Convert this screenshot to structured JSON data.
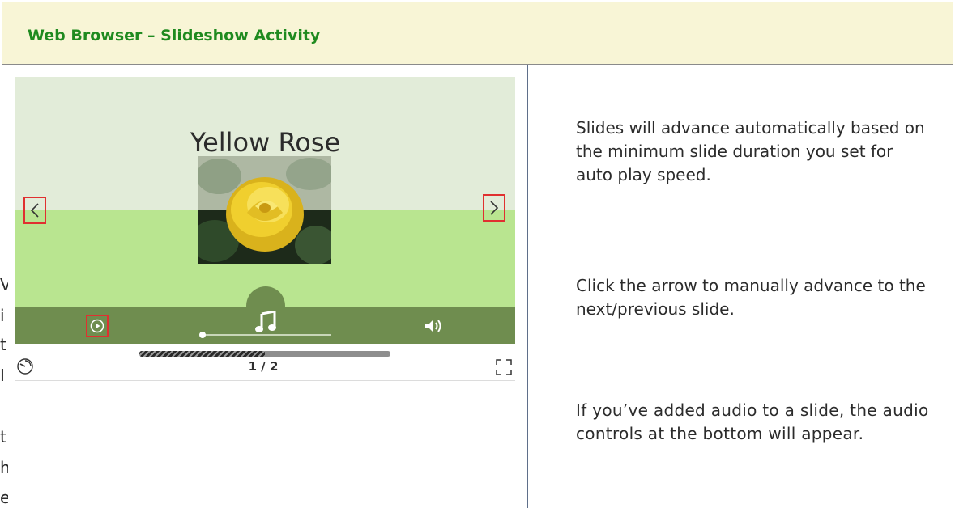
{
  "header": {
    "title": "Web Browser – Slideshow Activity"
  },
  "slideshow": {
    "slide_title": "Yellow Rose",
    "page_counter": "1 / 2",
    "progress": 0.5,
    "audio_position": 0.0
  },
  "left_fragments": [
    "V",
    "i",
    "t",
    "I",
    "t",
    "h",
    "e"
  ],
  "instructions": {
    "p1": "Slides will advance automatically based on the minimum slide duration you set for auto play speed.",
    "p2": "Click the arrow to manually advance to the next/previous slide.",
    "p3": "If you’ve added audio to a slide, the audio controls at the bottom will appear."
  },
  "colors": {
    "header_bg": "#f8f5d6",
    "header_text": "#1f8a1f",
    "slide_green": "#b9e590",
    "control_bar": "#6f8d4f",
    "highlight_box": "#e03030"
  },
  "icons": [
    "prev-arrow-icon",
    "next-arrow-icon",
    "play-icon",
    "music-note-icon",
    "volume-icon",
    "autoplay-icon",
    "fullscreen-icon"
  ]
}
